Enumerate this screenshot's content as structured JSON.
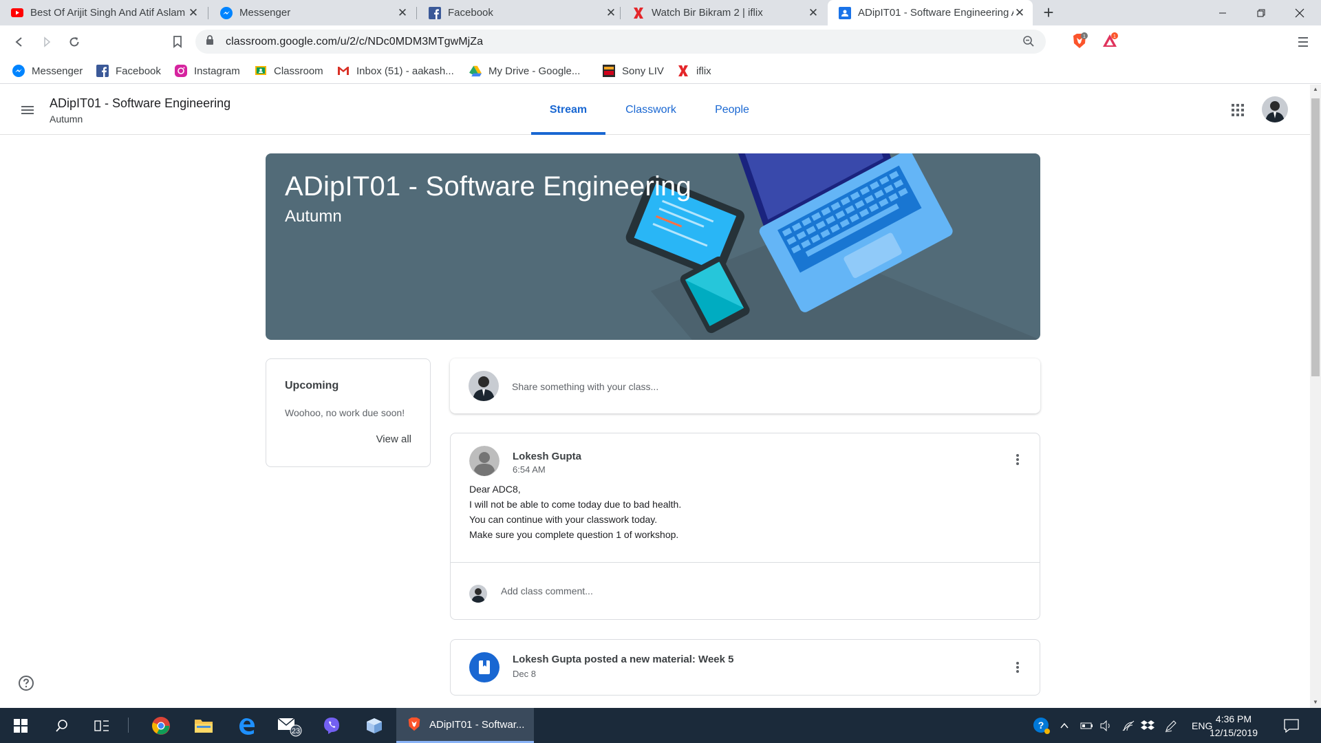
{
  "browser": {
    "tabs": [
      {
        "title": "Best Of Arijit Singh And Atif Aslam",
        "icon": "youtube-icon",
        "active": false
      },
      {
        "title": "Messenger",
        "icon": "messenger-icon",
        "active": false
      },
      {
        "title": "Facebook",
        "icon": "facebook-icon",
        "active": false
      },
      {
        "title": "Watch Bir Bikram 2 | iflix",
        "icon": "iflix-icon",
        "active": false
      },
      {
        "title": "ADipIT01 - Software Engineering A",
        "icon": "classroom-icon",
        "active": true
      }
    ],
    "url": "classroom.google.com/u/2/c/NDc0MDM3MTgwMjZa",
    "extension_badges": {
      "brave_shields": "1",
      "brave_rewards": "1"
    },
    "bookmarks": [
      {
        "label": "Messenger",
        "icon": "messenger-icon"
      },
      {
        "label": "Facebook",
        "icon": "facebook-icon"
      },
      {
        "label": "Instagram",
        "icon": "instagram-icon"
      },
      {
        "label": "Classroom",
        "icon": "classroom-icon"
      },
      {
        "label": "Inbox (51) - aakash...",
        "icon": "gmail-icon"
      },
      {
        "label": "My Drive - Google...",
        "icon": "drive-icon"
      },
      {
        "label": "Sony LIV",
        "icon": "sonyliv-icon"
      },
      {
        "label": "iflix",
        "icon": "iflix-icon"
      }
    ]
  },
  "classroom": {
    "header": {
      "title": "ADipIT01 - Software Engineering",
      "subtitle": "Autumn",
      "tabs": [
        "Stream",
        "Classwork",
        "People"
      ],
      "active_tab": "Stream"
    },
    "banner": {
      "title": "ADipIT01 - Software Engineering",
      "subtitle": "Autumn"
    },
    "upcoming": {
      "title": "Upcoming",
      "text": "Woohoo, no work due soon!",
      "link": "View all"
    },
    "share": {
      "placeholder": "Share something with your class..."
    },
    "post": {
      "author": "Lokesh Gupta",
      "time": "6:54 AM",
      "lines": [
        "Dear ADC8,",
        "I will not be able to come today due to bad health.",
        "You can continue with your classwork today.",
        "Make sure you complete question 1 of workshop."
      ],
      "comment_placeholder": "Add class comment..."
    },
    "material": {
      "title": "Lokesh Gupta posted a new material: Week 5",
      "date": "Dec 8"
    }
  },
  "taskbar": {
    "active_window": "ADipIT01 - Softwar...",
    "mail_badge": "23",
    "language": "ENG",
    "time": "4:36 PM",
    "date": "12/15/2019"
  },
  "colors": {
    "accent": "#1967d2",
    "banner": "#526b78",
    "taskbar": "#1b2a3a"
  }
}
